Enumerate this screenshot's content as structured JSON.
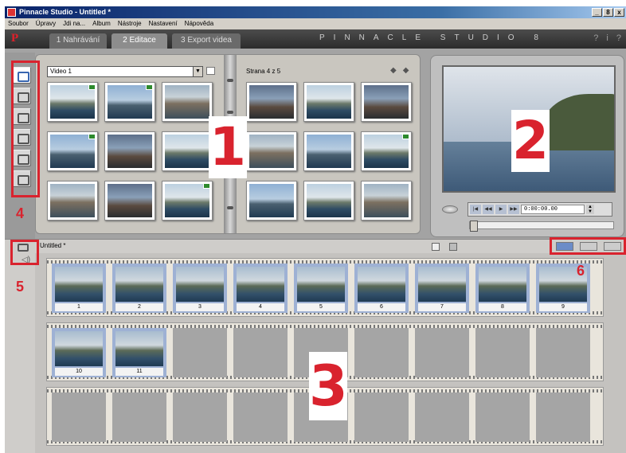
{
  "window": {
    "title": "Pinnacle Studio - Untitled *",
    "controls": [
      "_",
      "8",
      "x"
    ]
  },
  "menu": [
    "Soubor",
    "Úpravy",
    "Jdi na...",
    "Album",
    "Nástroje",
    "Nastavení",
    "Nápověda"
  ],
  "nav": {
    "logo": "P",
    "tabs": [
      "1 Nahrávání",
      "2 Editace",
      "3 Export videa"
    ],
    "active_tab": 1,
    "brand": "PINNACLE STUDIO 8",
    "help_icons": [
      "?",
      "i",
      "?"
    ]
  },
  "album": {
    "dropdown_value": "Video 1",
    "page_info": "Strana 4 z 5"
  },
  "preview": {
    "timecode": "0:00:00.00"
  },
  "movie": {
    "title": "Untitled *"
  },
  "timeline": {
    "row1_numbers": [
      "1",
      "2",
      "3",
      "4",
      "5",
      "6",
      "7",
      "8",
      "9"
    ],
    "row2_numbers": [
      "10",
      "11"
    ]
  },
  "annotations": {
    "n1": "1",
    "n2": "2",
    "n3": "3",
    "n4": "4",
    "n5": "5",
    "n6": "6"
  },
  "colors": {
    "annotation_red": "#d9232e",
    "clip_blue": "#9eb1d4",
    "nav_dark": "#2c2c2c"
  }
}
